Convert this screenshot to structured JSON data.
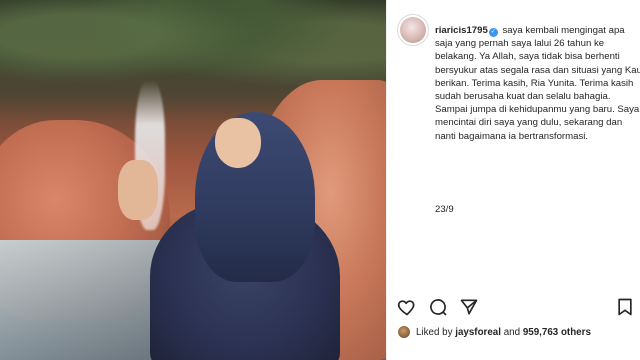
{
  "post": {
    "username": "riaricis1795",
    "verified_badge": "verified-icon",
    "caption": "saya kembali mengingat apa saja yang pernah saya lalui 26 tahun ke belakang. Ya Allah, saya tidak bisa berhenti bersyukur atas segala rasa dan situasi yang Kau berikan. Terima kasih, Ria Yunita. Terima kasih sudah berusaha kuat dan selalu bahagia. Sampai jumpa di kehidupanmu yang baru. Saya mencintai diri saya yang dulu, sekarang dan nanti bagaimana ia bertransformasi.",
    "date": "23/9"
  },
  "likes": {
    "prefix": "Liked by",
    "user": "jaysforeal",
    "conjunction": "and",
    "count_text": "959,763 others"
  },
  "icons": {
    "like": "heart-icon",
    "comment": "comment-icon",
    "share": "share-icon",
    "save": "bookmark-icon"
  },
  "colors": {
    "verified": "#3897f0",
    "text": "#262626",
    "border": "#efefef"
  }
}
